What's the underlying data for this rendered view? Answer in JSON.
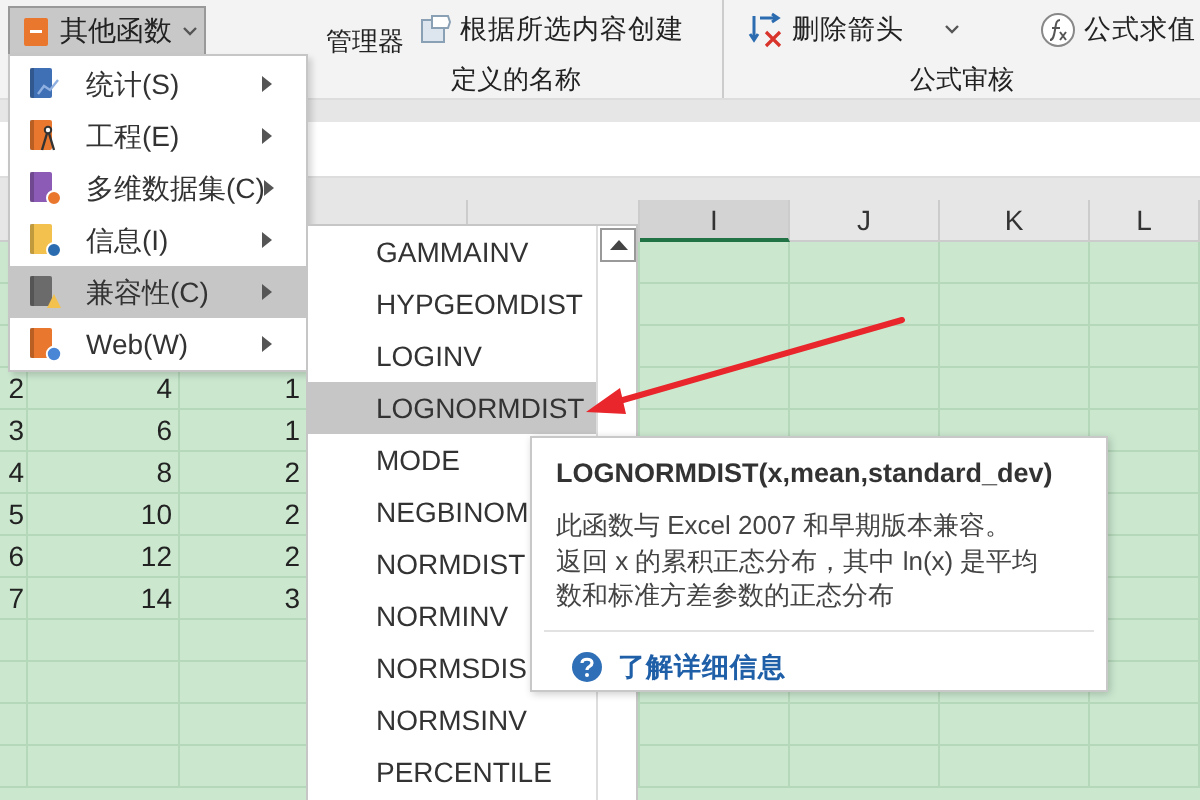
{
  "ribbon": {
    "menu_button": {
      "label": "其他函数",
      "pressed": true
    },
    "groups": [
      {
        "label": "定义的名称",
        "buttons": [
          {
            "kind": "large",
            "lines": [
              "管理器"
            ]
          },
          {
            "kind": "small",
            "label": "根据所选内容创建",
            "dropdown": false
          }
        ]
      },
      {
        "label": "公式审核",
        "buttons": [
          {
            "kind": "small",
            "label": "删除箭头",
            "dropdown": true
          },
          {
            "kind": "small",
            "label": "公式求值",
            "dropdown": false
          }
        ]
      }
    ]
  },
  "sheet": {
    "columns": [
      {
        "label": "I",
        "selected": true
      },
      {
        "label": "J",
        "selected": false
      },
      {
        "label": "K",
        "selected": false
      },
      {
        "label": "L",
        "selected": false
      }
    ],
    "rows": [
      {
        "column_1": "2",
        "column_2": "4",
        "column_3": "1"
      },
      {
        "column_1": "3",
        "column_2": "6",
        "column_3": "1"
      },
      {
        "column_1": "4",
        "column_2": "8",
        "column_3": "2"
      },
      {
        "column_1": "5",
        "column_2": "10",
        "column_3": "2"
      },
      {
        "column_1": "6",
        "column_2": "12",
        "column_3": "2"
      },
      {
        "column_1": "7",
        "column_2": "14",
        "column_3": "3"
      }
    ]
  },
  "menu": {
    "items": [
      {
        "label": "统计(S)",
        "selected": false
      },
      {
        "label": "工程(E)",
        "selected": false
      },
      {
        "label": "多维数据集(C)",
        "selected": false
      },
      {
        "label": "信息(I)",
        "selected": false
      },
      {
        "label": "兼容性(C)",
        "selected": true
      },
      {
        "label": "Web(W)",
        "selected": false
      }
    ]
  },
  "submenu": {
    "items": [
      {
        "label": "GAMMAINV",
        "selected": false
      },
      {
        "label": "HYPGEOMDIST",
        "selected": false
      },
      {
        "label": "LOGINV",
        "selected": false
      },
      {
        "label": "LOGNORMDIST",
        "selected": true
      },
      {
        "label": "MODE",
        "selected": false
      },
      {
        "label": "NEGBINOM",
        "selected": false
      },
      {
        "label": "NORMDIST",
        "selected": false
      },
      {
        "label": "NORMINV",
        "selected": false
      },
      {
        "label": "NORMSDIS",
        "selected": false
      },
      {
        "label": "NORMSINV",
        "selected": false
      },
      {
        "label": "PERCENTILE",
        "selected": false
      }
    ]
  },
  "tooltip": {
    "title": "LOGNORMDIST(x,mean,standard_dev)",
    "lines": [
      "此函数与 Excel 2007 和早期版本兼容。",
      "返回 x 的累积正态分布，其中 ln(x) 是平均",
      "数和标准方差参数的正态分布"
    ],
    "link": "了解详细信息"
  }
}
